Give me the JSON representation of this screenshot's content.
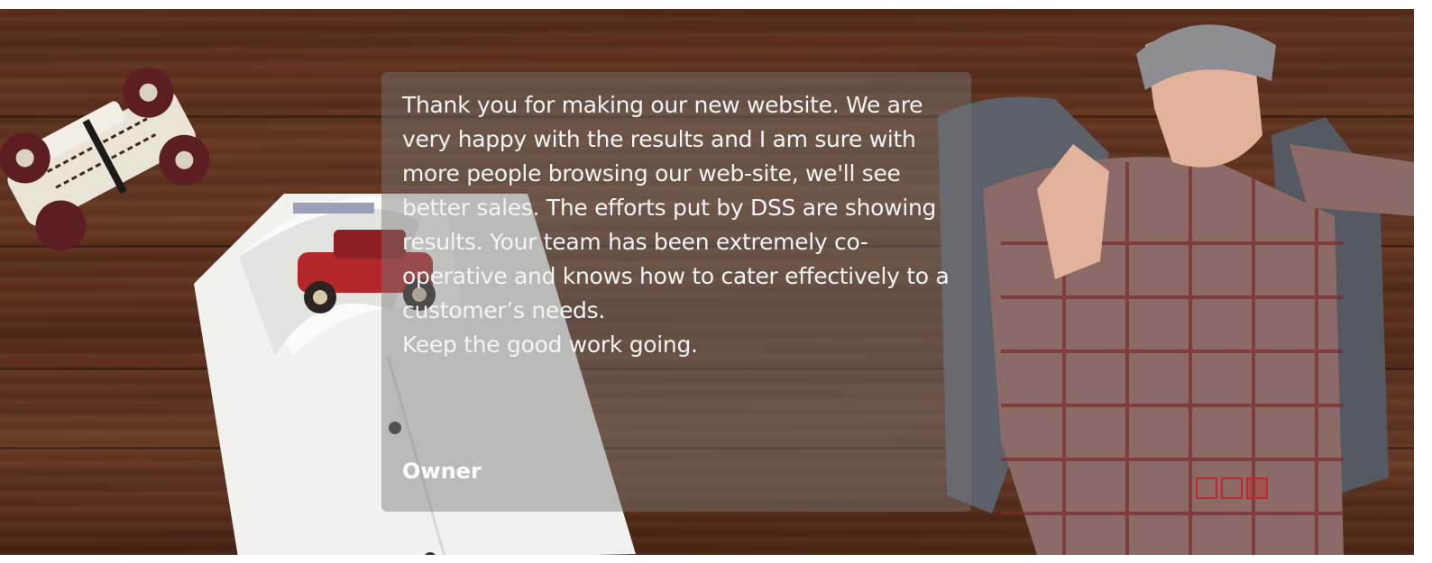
{
  "testimonial": {
    "quote": "Thank you for making our new website. We are very happy with the results and I am sure with more people browsing our web-site, we'll see better sales. The efforts put by DSS are showing results. Your team has been extremely co-operative and knows how to cater effectively to a customer’s needs.\nKeep the good work going.",
    "author": "Owner"
  },
  "slider": {
    "total_slides": 3,
    "active_index": 2
  },
  "colors": {
    "accent": "#c0282a",
    "panel": "#787878",
    "wood": "#5e2f1c"
  },
  "images": [
    "toy-car-image",
    "folded-shirt-image",
    "model-image"
  ]
}
